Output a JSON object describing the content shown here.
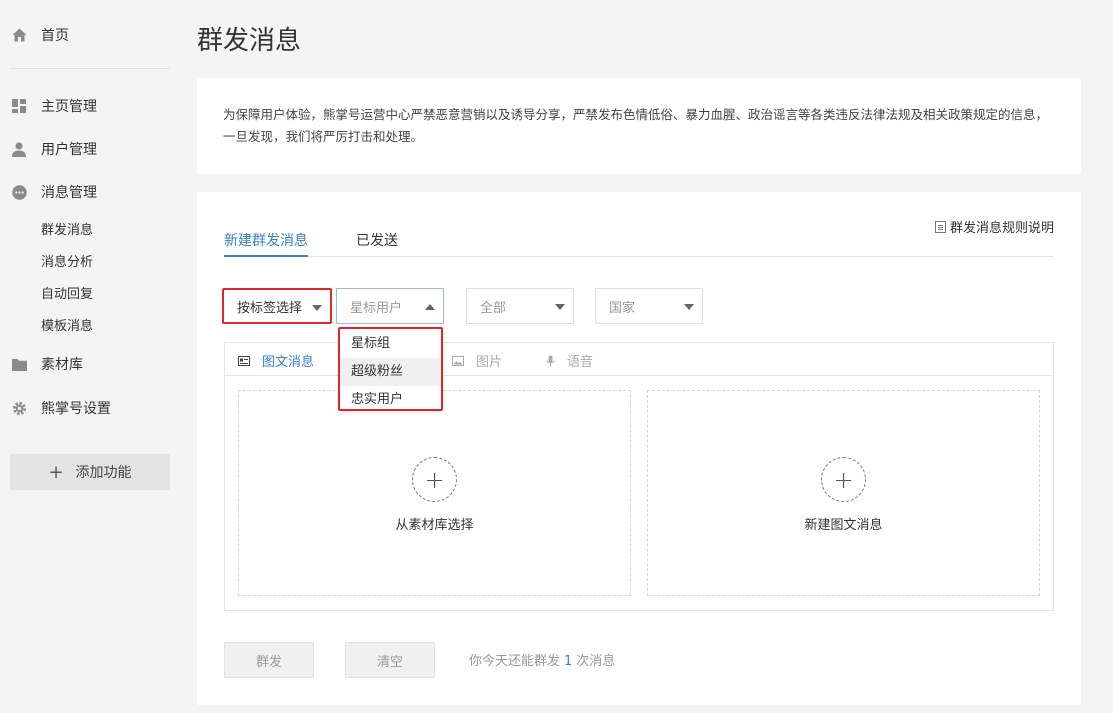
{
  "sidebar": {
    "home": "首页",
    "homepage_mgmt": "主页管理",
    "user_mgmt": "用户管理",
    "message_mgmt": "消息管理",
    "message_sub": [
      "群发消息",
      "消息分析",
      "自动回复",
      "模板消息"
    ],
    "material": "素材库",
    "settings": "熊掌号设置",
    "add_function": "添加功能"
  },
  "page": {
    "title": "群发消息",
    "notice": "为保障用户体验，熊掌号运营中心严禁恶意营销以及诱导分享，严禁发布色情低俗、暴力血腥、政治谣言等各类违反法律法规及相关政策规定的信息，一旦发现，我们将严厉打击和处理。"
  },
  "tabs": {
    "new": "新建群发消息",
    "sent": "已发送",
    "rules": "群发消息规则说明"
  },
  "filters": {
    "by_tag": "按标签选择",
    "star_user": "星标用户",
    "all": "全部",
    "country": "国家"
  },
  "dropdown": {
    "items": [
      "星标组",
      "超级粉丝",
      "忠实用户"
    ]
  },
  "editor": {
    "tabs": [
      "图文消息",
      "图片",
      "语音"
    ],
    "from_library": "从素材库选择",
    "new_article": "新建图文消息"
  },
  "actions": {
    "send": "群发",
    "clear": "清空",
    "quota_prefix": "你今天还能群发",
    "quota_count": "1",
    "quota_suffix": "次消息"
  },
  "colors": {
    "accent": "#3b7fd0",
    "highlight_red": "#e0252b"
  }
}
